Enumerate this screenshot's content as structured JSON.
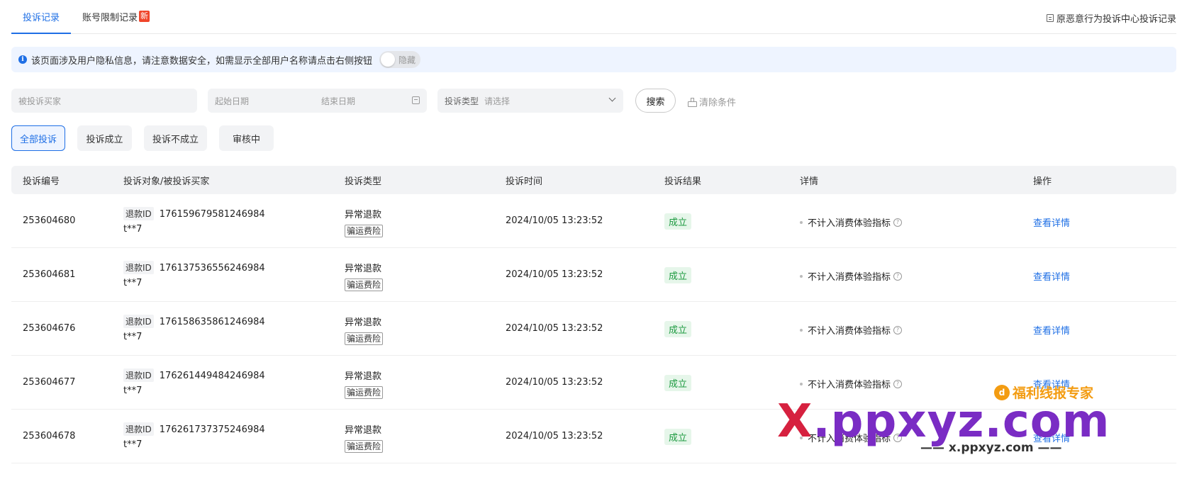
{
  "tabs": [
    {
      "label": "投诉记录",
      "active": true
    },
    {
      "label": "账号限制记录",
      "active": false,
      "badge": "新"
    }
  ],
  "right_link": "原恶意行为投诉中心投诉记录",
  "notice": {
    "text": "该页面涉及用户隐私信息，请注意数据安全，如需显示全部用户名称请点击右侧按钮",
    "toggle_label": "隐藏"
  },
  "filters": {
    "buyer_placeholder": "被投诉买家",
    "start_date_placeholder": "起始日期",
    "end_date_placeholder": "结束日期",
    "type_label": "投诉类型",
    "type_placeholder": "请选择",
    "search_label": "搜索",
    "clear_label": "清除条件"
  },
  "status_chips": [
    {
      "label": "全部投诉",
      "active": true
    },
    {
      "label": "投诉成立",
      "active": false
    },
    {
      "label": "投诉不成立",
      "active": false
    },
    {
      "label": "审核中",
      "active": false
    }
  ],
  "table": {
    "headers": [
      "投诉编号",
      "投诉对象/被投诉买家",
      "投诉类型",
      "投诉时间",
      "投诉结果",
      "详情",
      "操作"
    ],
    "rows": [
      {
        "id": "253604680",
        "refund_tag": "退款ID",
        "refund_id": "176159679581246984",
        "buyer": "t**7",
        "type": "异常退款",
        "type_tag": "骗运费险",
        "time": "2024/10/05 13:23:52",
        "result": "成立",
        "detail": "不计入消费体验指标",
        "action": "查看详情"
      },
      {
        "id": "253604681",
        "refund_tag": "退款ID",
        "refund_id": "176137536556246984",
        "buyer": "t**7",
        "type": "异常退款",
        "type_tag": "骗运费险",
        "time": "2024/10/05 13:23:52",
        "result": "成立",
        "detail": "不计入消费体验指标",
        "action": "查看详情"
      },
      {
        "id": "253604676",
        "refund_tag": "退款ID",
        "refund_id": "176158635861246984",
        "buyer": "t**7",
        "type": "异常退款",
        "type_tag": "骗运费险",
        "time": "2024/10/05 13:23:52",
        "result": "成立",
        "detail": "不计入消费体验指标",
        "action": "查看详情"
      },
      {
        "id": "253604677",
        "refund_tag": "退款ID",
        "refund_id": "176261449484246984",
        "buyer": "t**7",
        "type": "异常退款",
        "type_tag": "骗运费险",
        "time": "2024/10/05 13:23:52",
        "result": "成立",
        "detail": "不计入消费体验指标",
        "action": "查看详情"
      },
      {
        "id": "253604678",
        "refund_tag": "退款ID",
        "refund_id": "176261737375246984",
        "buyer": "t**7",
        "type": "异常退款",
        "type_tag": "骗运费险",
        "time": "2024/10/05 13:23:52",
        "result": "成立",
        "detail": "不计入消费体验指标",
        "action": "查看详情"
      }
    ]
  },
  "watermark": {
    "top": "福利线报专家",
    "main_x": "X",
    "main_rest": ".ppxyz.com",
    "sub": "—— x.ppxyz.com ——"
  },
  "colors": {
    "accent": "#1f6fe5",
    "success": "#1d9a40",
    "badge": "#f0452a"
  }
}
